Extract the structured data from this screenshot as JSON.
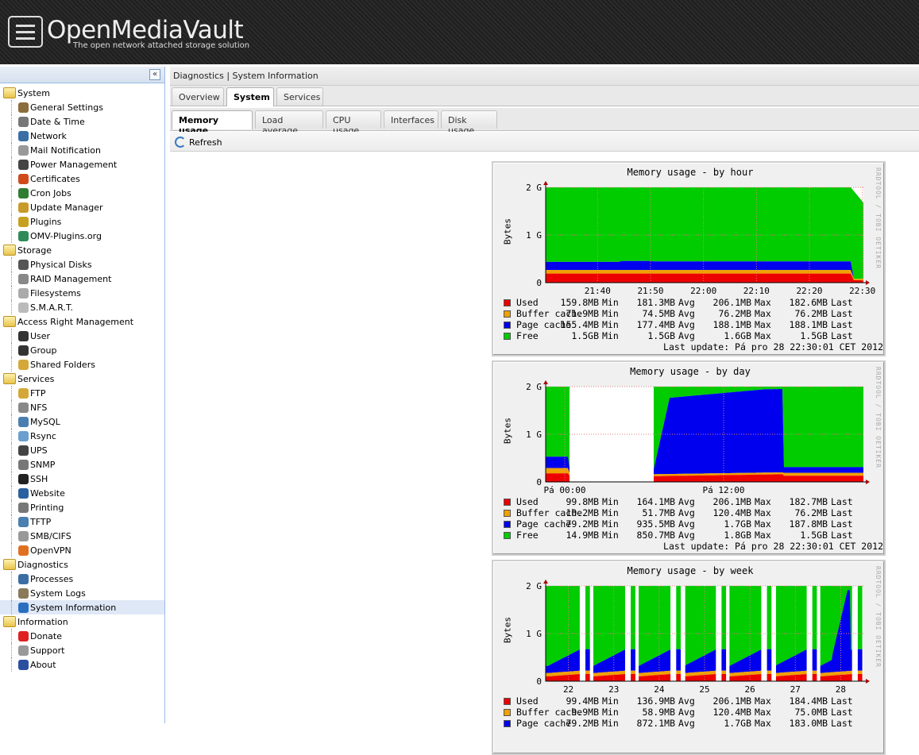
{
  "header": {
    "logo": "OpenMediaVault",
    "slogan": "The open network attached storage solution"
  },
  "sidebar": {
    "collapse": "«",
    "nodes": [
      {
        "label": "System",
        "folder": true,
        "depth": 0
      },
      {
        "label": "General Settings",
        "icon": "tools-icon",
        "color": "#8a6d3b",
        "depth": 1
      },
      {
        "label": "Date & Time",
        "icon": "clock-icon",
        "color": "#777777",
        "depth": 1
      },
      {
        "label": "Network",
        "icon": "network-icon",
        "color": "#3a6ea5",
        "depth": 1
      },
      {
        "label": "Mail Notification",
        "icon": "mail-icon",
        "color": "#999999",
        "depth": 1
      },
      {
        "label": "Power Management",
        "icon": "power-icon",
        "color": "#444444",
        "depth": 1
      },
      {
        "label": "Certificates",
        "icon": "certificate-icon",
        "color": "#d04a1c",
        "depth": 1
      },
      {
        "label": "Cron Jobs",
        "icon": "cron-icon",
        "color": "#2f7d32",
        "depth": 1
      },
      {
        "label": "Update Manager",
        "icon": "update-icon",
        "color": "#c89a2a",
        "depth": 1
      },
      {
        "label": "Plugins",
        "icon": "plugin-icon",
        "color": "#c8a020",
        "depth": 1
      },
      {
        "label": "OMV-Plugins.org",
        "icon": "globe-icon",
        "color": "#2e8b57",
        "depth": 1
      },
      {
        "label": "Storage",
        "folder": true,
        "depth": 0
      },
      {
        "label": "Physical Disks",
        "icon": "disk-icon",
        "color": "#555555",
        "depth": 1
      },
      {
        "label": "RAID Management",
        "icon": "raid-icon",
        "color": "#888888",
        "depth": 1
      },
      {
        "label": "Filesystems",
        "icon": "filesystem-icon",
        "color": "#aaaaaa",
        "depth": 1
      },
      {
        "label": "S.M.A.R.T.",
        "icon": "smart-icon",
        "color": "#bbbbbb",
        "depth": 1
      },
      {
        "label": "Access Right Management",
        "folder": true,
        "depth": 0
      },
      {
        "label": "User",
        "icon": "user-icon",
        "color": "#333333",
        "depth": 1
      },
      {
        "label": "Group",
        "icon": "group-icon",
        "color": "#333333",
        "depth": 1
      },
      {
        "label": "Shared Folders",
        "icon": "shared-folder-icon",
        "color": "#d4a838",
        "depth": 1
      },
      {
        "label": "Services",
        "folder": true,
        "depth": 0
      },
      {
        "label": "FTP",
        "icon": "ftp-icon",
        "color": "#d4a838",
        "depth": 1
      },
      {
        "label": "NFS",
        "icon": "nfs-icon",
        "color": "#888888",
        "depth": 1
      },
      {
        "label": "MySQL",
        "icon": "mysql-icon",
        "color": "#4a7fb0",
        "depth": 1
      },
      {
        "label": "Rsync",
        "icon": "rsync-icon",
        "color": "#6a9fd0",
        "depth": 1
      },
      {
        "label": "UPS",
        "icon": "ups-icon",
        "color": "#444444",
        "depth": 1
      },
      {
        "label": "SNMP",
        "icon": "snmp-icon",
        "color": "#777777",
        "depth": 1
      },
      {
        "label": "SSH",
        "icon": "ssh-icon",
        "color": "#222222",
        "depth": 1
      },
      {
        "label": "Website",
        "icon": "website-icon",
        "color": "#2a5fa0",
        "depth": 1
      },
      {
        "label": "Printing",
        "icon": "printer-icon",
        "color": "#777777",
        "depth": 1
      },
      {
        "label": "TFTP",
        "icon": "tftp-icon",
        "color": "#4a7fb0",
        "depth": 1
      },
      {
        "label": "SMB/CIFS",
        "icon": "smb-icon",
        "color": "#999999",
        "depth": 1
      },
      {
        "label": "OpenVPN",
        "icon": "openvpn-icon",
        "color": "#e07020",
        "depth": 1
      },
      {
        "label": "Diagnostics",
        "folder": true,
        "depth": 0
      },
      {
        "label": "Processes",
        "icon": "processes-icon",
        "color": "#3a6ea5",
        "depth": 1
      },
      {
        "label": "System Logs",
        "icon": "logs-icon",
        "color": "#8a7a5a",
        "depth": 1
      },
      {
        "label": "System Information",
        "icon": "info-icon",
        "color": "#2a6fc0",
        "depth": 1,
        "selected": true
      },
      {
        "label": "Information",
        "folder": true,
        "depth": 0
      },
      {
        "label": "Donate",
        "icon": "heart-icon",
        "color": "#e02020",
        "depth": 1
      },
      {
        "label": "Support",
        "icon": "support-icon",
        "color": "#999999",
        "depth": 1
      },
      {
        "label": "About",
        "icon": "about-icon",
        "color": "#2a4fa0",
        "depth": 1
      }
    ]
  },
  "breadcrumb": "Diagnostics | System Information",
  "tabs1": [
    {
      "label": "Overview",
      "active": false
    },
    {
      "label": "System",
      "active": true
    },
    {
      "label": "Services",
      "active": false
    }
  ],
  "tabs2": [
    {
      "label": "Memory usage",
      "active": true
    },
    {
      "label": "Load average",
      "active": false
    },
    {
      "label": "CPU usage",
      "active": false
    },
    {
      "label": "Interfaces",
      "active": false
    },
    {
      "label": "Disk usage",
      "active": false
    }
  ],
  "toolbar": {
    "refresh": "Refresh"
  },
  "colors": {
    "used": "#ee0000",
    "buffer": "#f0a000",
    "page": "#0000ee",
    "free": "#00cc00"
  },
  "graphs": [
    {
      "title": "Memory usage - by hour",
      "ylabel": "Bytes",
      "watermark": "RRDTOOL / TOBI OETIKER",
      "yticks": [
        "0",
        "1 G",
        "2 G"
      ],
      "xticks": [
        "21:40",
        "21:50",
        "22:00",
        "22:10",
        "22:20",
        "22:30"
      ],
      "legend": [
        {
          "name": "Used",
          "min": "159.8MB",
          "avg": "181.3MB",
          "max": "206.1MB",
          "last": "182.6MB"
        },
        {
          "name": "Buffer cache",
          "min": "71.9MB",
          "avg": "74.5MB",
          "max": "76.2MB",
          "last": "76.2MB"
        },
        {
          "name": "Page cache",
          "min": "155.4MB",
          "avg": "177.4MB",
          "max": "188.1MB",
          "last": "188.1MB"
        },
        {
          "name": "Free",
          "min": "1.5GB",
          "avg": "1.5GB",
          "max": "1.6GB",
          "last": "1.5GB"
        }
      ],
      "lastupdate": "Last update: Pá pro 28 22:30:01 CET 2012"
    },
    {
      "title": "Memory usage - by day",
      "ylabel": "Bytes",
      "watermark": "RRDTOOL / TOBI OETIKER",
      "yticks": [
        "0",
        "1 G",
        "2 G"
      ],
      "xticks": [
        "Pá 00:00",
        "Pá 12:00"
      ],
      "legend": [
        {
          "name": "Used",
          "min": "99.8MB",
          "avg": "164.1MB",
          "max": "206.1MB",
          "last": "182.7MB"
        },
        {
          "name": "Buffer cache",
          "min": "10.2MB",
          "avg": "51.7MB",
          "max": "120.4MB",
          "last": "76.2MB"
        },
        {
          "name": "Page cache",
          "min": "79.2MB",
          "avg": "935.5MB",
          "max": "1.7GB",
          "last": "187.8MB"
        },
        {
          "name": "Free",
          "min": "14.9MB",
          "avg": "850.7MB",
          "max": "1.8GB",
          "last": "1.5GB"
        }
      ],
      "lastupdate": "Last update: Pá pro 28 22:30:01 CET 2012"
    },
    {
      "title": "Memory usage - by week",
      "ylabel": "Bytes",
      "watermark": "RRDTOOL / TOBI OETIKER",
      "yticks": [
        "0",
        "1 G",
        "2 G"
      ],
      "xticks": [
        "22",
        "23",
        "24",
        "25",
        "26",
        "27",
        "28"
      ],
      "legend": [
        {
          "name": "Used",
          "min": "99.4MB",
          "avg": "136.9MB",
          "max": "206.1MB",
          "last": "184.4MB"
        },
        {
          "name": "Buffer cache",
          "min": "9.9MB",
          "avg": "58.9MB",
          "max": "120.4MB",
          "last": "75.0MB"
        },
        {
          "name": "Page cache",
          "min": "79.2MB",
          "avg": "872.1MB",
          "max": "1.7GB",
          "last": "183.0MB"
        }
      ],
      "lastupdate": ""
    }
  ]
}
